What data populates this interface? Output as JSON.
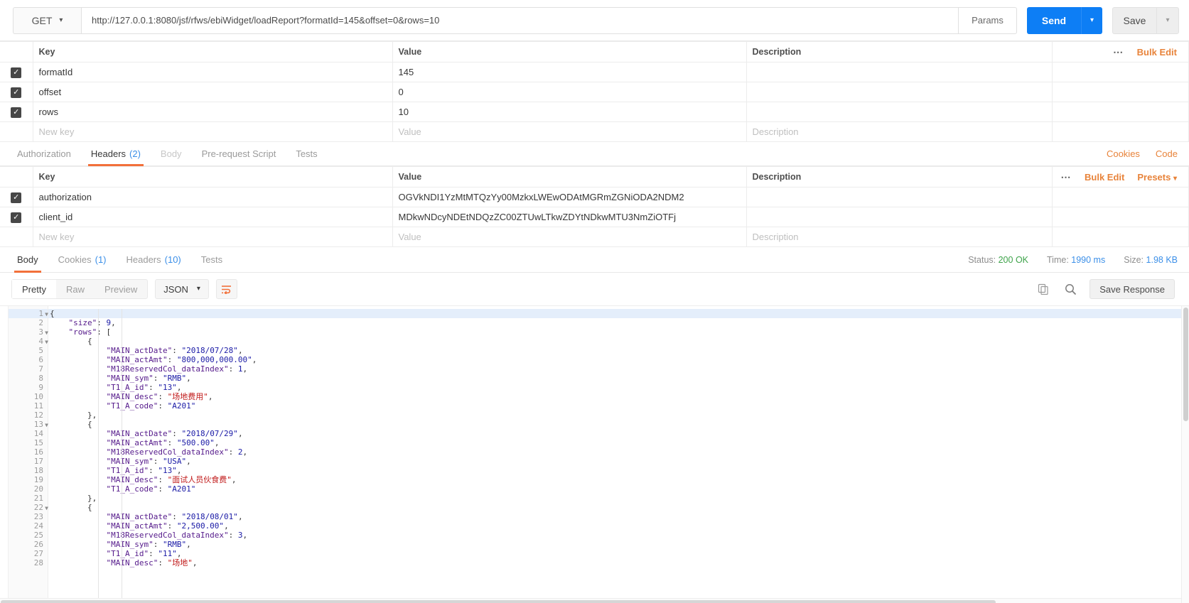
{
  "urlbar": {
    "method": "GET",
    "url": "http://127.0.0.1:8080/jsf/rfws/ebiWidget/loadReport?formatId=145&offset=0&rows=10",
    "params_label": "Params",
    "send_label": "Send",
    "save_label": "Save"
  },
  "params_table": {
    "headers": {
      "key": "Key",
      "value": "Value",
      "description": "Description"
    },
    "bulk_edit": "Bulk Edit",
    "rows": [
      {
        "checked": true,
        "key": "formatId",
        "value": "145",
        "description": ""
      },
      {
        "checked": true,
        "key": "offset",
        "value": "0",
        "description": ""
      },
      {
        "checked": true,
        "key": "rows",
        "value": "10",
        "description": ""
      }
    ],
    "new_row": {
      "key": "New key",
      "value": "Value",
      "description": "Description"
    }
  },
  "request_tabs": {
    "items": [
      {
        "label": "Authorization",
        "count": "",
        "active": false,
        "dim": false
      },
      {
        "label": "Headers",
        "count": "(2)",
        "active": true,
        "dim": false
      },
      {
        "label": "Body",
        "count": "",
        "active": false,
        "dim": true
      },
      {
        "label": "Pre-request Script",
        "count": "",
        "active": false,
        "dim": false
      },
      {
        "label": "Tests",
        "count": "",
        "active": false,
        "dim": false
      }
    ],
    "cookies_link": "Cookies",
    "code_link": "Code"
  },
  "headers_table": {
    "headers": {
      "key": "Key",
      "value": "Value",
      "description": "Description"
    },
    "bulk_edit": "Bulk Edit",
    "presets": "Presets",
    "rows": [
      {
        "checked": true,
        "key": "authorization",
        "value": "OGVkNDI1YzMtMTQzYy00MzkxLWEwODAtMGRmZGNiODA2NDM2",
        "description": ""
      },
      {
        "checked": true,
        "key": "client_id",
        "value": "MDkwNDcyNDEtNDQzZC00ZTUwLTkwZDYtNDkwMTU3NmZiOTFj",
        "description": ""
      }
    ],
    "new_row": {
      "key": "New key",
      "value": "Value",
      "description": "Description"
    }
  },
  "response_tabs": {
    "items": [
      {
        "label": "Body",
        "count": "",
        "active": true
      },
      {
        "label": "Cookies",
        "count": "(1)",
        "active": false
      },
      {
        "label": "Headers",
        "count": "(10)",
        "active": false
      },
      {
        "label": "Tests",
        "count": "",
        "active": false
      }
    ],
    "status_label": "Status:",
    "status_value": "200 OK",
    "time_label": "Time:",
    "time_value": "1990 ms",
    "size_label": "Size:",
    "size_value": "1.98 KB"
  },
  "editor_toolbar": {
    "pretty": "Pretty",
    "raw": "Raw",
    "preview": "Preview",
    "format": "JSON",
    "save_response": "Save Response"
  },
  "response_body": {
    "lines": [
      {
        "n": 1,
        "fold": true,
        "hl": true,
        "tokens": [
          [
            "p",
            "{"
          ]
        ]
      },
      {
        "n": 2,
        "fold": false,
        "hl": false,
        "tokens": [
          [
            "p",
            "    "
          ],
          [
            "k",
            "\"size\""
          ],
          [
            "p",
            ": "
          ],
          [
            "n",
            "9"
          ],
          [
            "p",
            ","
          ]
        ]
      },
      {
        "n": 3,
        "fold": true,
        "hl": false,
        "tokens": [
          [
            "p",
            "    "
          ],
          [
            "k",
            "\"rows\""
          ],
          [
            "p",
            ": ["
          ]
        ]
      },
      {
        "n": 4,
        "fold": true,
        "hl": false,
        "tokens": [
          [
            "p",
            "        {"
          ]
        ]
      },
      {
        "n": 5,
        "fold": false,
        "hl": false,
        "tokens": [
          [
            "p",
            "            "
          ],
          [
            "k",
            "\"MAIN_actDate\""
          ],
          [
            "p",
            ": "
          ],
          [
            "s",
            "\"2018/07/28\""
          ],
          [
            "p",
            ","
          ]
        ]
      },
      {
        "n": 6,
        "fold": false,
        "hl": false,
        "tokens": [
          [
            "p",
            "            "
          ],
          [
            "k",
            "\"MAIN_actAmt\""
          ],
          [
            "p",
            ": "
          ],
          [
            "s",
            "\"800,000,000.00\""
          ],
          [
            "p",
            ","
          ]
        ]
      },
      {
        "n": 7,
        "fold": false,
        "hl": false,
        "tokens": [
          [
            "p",
            "            "
          ],
          [
            "k",
            "\"M18ReservedCol_dataIndex\""
          ],
          [
            "p",
            ": "
          ],
          [
            "n",
            "1"
          ],
          [
            "p",
            ","
          ]
        ]
      },
      {
        "n": 8,
        "fold": false,
        "hl": false,
        "tokens": [
          [
            "p",
            "            "
          ],
          [
            "k",
            "\"MAIN_sym\""
          ],
          [
            "p",
            ": "
          ],
          [
            "s",
            "\"RMB\""
          ],
          [
            "p",
            ","
          ]
        ]
      },
      {
        "n": 9,
        "fold": false,
        "hl": false,
        "tokens": [
          [
            "p",
            "            "
          ],
          [
            "k",
            "\"T1_A_id\""
          ],
          [
            "p",
            ": "
          ],
          [
            "s",
            "\"13\""
          ],
          [
            "p",
            ","
          ]
        ]
      },
      {
        "n": 10,
        "fold": false,
        "hl": false,
        "tokens": [
          [
            "p",
            "            "
          ],
          [
            "k",
            "\"MAIN_desc\""
          ],
          [
            "p",
            ": "
          ],
          [
            "cn",
            "\"场地费用\""
          ],
          [
            "p",
            ","
          ]
        ]
      },
      {
        "n": 11,
        "fold": false,
        "hl": false,
        "tokens": [
          [
            "p",
            "            "
          ],
          [
            "k",
            "\"T1_A_code\""
          ],
          [
            "p",
            ": "
          ],
          [
            "s",
            "\"A201\""
          ]
        ]
      },
      {
        "n": 12,
        "fold": false,
        "hl": false,
        "tokens": [
          [
            "p",
            "        },"
          ]
        ]
      },
      {
        "n": 13,
        "fold": true,
        "hl": false,
        "tokens": [
          [
            "p",
            "        {"
          ]
        ]
      },
      {
        "n": 14,
        "fold": false,
        "hl": false,
        "tokens": [
          [
            "p",
            "            "
          ],
          [
            "k",
            "\"MAIN_actDate\""
          ],
          [
            "p",
            ": "
          ],
          [
            "s",
            "\"2018/07/29\""
          ],
          [
            "p",
            ","
          ]
        ]
      },
      {
        "n": 15,
        "fold": false,
        "hl": false,
        "tokens": [
          [
            "p",
            "            "
          ],
          [
            "k",
            "\"MAIN_actAmt\""
          ],
          [
            "p",
            ": "
          ],
          [
            "s",
            "\"500.00\""
          ],
          [
            "p",
            ","
          ]
        ]
      },
      {
        "n": 16,
        "fold": false,
        "hl": false,
        "tokens": [
          [
            "p",
            "            "
          ],
          [
            "k",
            "\"M18ReservedCol_dataIndex\""
          ],
          [
            "p",
            ": "
          ],
          [
            "n",
            "2"
          ],
          [
            "p",
            ","
          ]
        ]
      },
      {
        "n": 17,
        "fold": false,
        "hl": false,
        "tokens": [
          [
            "p",
            "            "
          ],
          [
            "k",
            "\"MAIN_sym\""
          ],
          [
            "p",
            ": "
          ],
          [
            "s",
            "\"USA\""
          ],
          [
            "p",
            ","
          ]
        ]
      },
      {
        "n": 18,
        "fold": false,
        "hl": false,
        "tokens": [
          [
            "p",
            "            "
          ],
          [
            "k",
            "\"T1_A_id\""
          ],
          [
            "p",
            ": "
          ],
          [
            "s",
            "\"13\""
          ],
          [
            "p",
            ","
          ]
        ]
      },
      {
        "n": 19,
        "fold": false,
        "hl": false,
        "tokens": [
          [
            "p",
            "            "
          ],
          [
            "k",
            "\"MAIN_desc\""
          ],
          [
            "p",
            ": "
          ],
          [
            "cn",
            "\"面试人员伙食费\""
          ],
          [
            "p",
            ","
          ]
        ]
      },
      {
        "n": 20,
        "fold": false,
        "hl": false,
        "tokens": [
          [
            "p",
            "            "
          ],
          [
            "k",
            "\"T1_A_code\""
          ],
          [
            "p",
            ": "
          ],
          [
            "s",
            "\"A201\""
          ]
        ]
      },
      {
        "n": 21,
        "fold": false,
        "hl": false,
        "tokens": [
          [
            "p",
            "        },"
          ]
        ]
      },
      {
        "n": 22,
        "fold": true,
        "hl": false,
        "tokens": [
          [
            "p",
            "        {"
          ]
        ]
      },
      {
        "n": 23,
        "fold": false,
        "hl": false,
        "tokens": [
          [
            "p",
            "            "
          ],
          [
            "k",
            "\"MAIN_actDate\""
          ],
          [
            "p",
            ": "
          ],
          [
            "s",
            "\"2018/08/01\""
          ],
          [
            "p",
            ","
          ]
        ]
      },
      {
        "n": 24,
        "fold": false,
        "hl": false,
        "tokens": [
          [
            "p",
            "            "
          ],
          [
            "k",
            "\"MAIN_actAmt\""
          ],
          [
            "p",
            ": "
          ],
          [
            "s",
            "\"2,500.00\""
          ],
          [
            "p",
            ","
          ]
        ]
      },
      {
        "n": 25,
        "fold": false,
        "hl": false,
        "tokens": [
          [
            "p",
            "            "
          ],
          [
            "k",
            "\"M18ReservedCol_dataIndex\""
          ],
          [
            "p",
            ": "
          ],
          [
            "n",
            "3"
          ],
          [
            "p",
            ","
          ]
        ]
      },
      {
        "n": 26,
        "fold": false,
        "hl": false,
        "tokens": [
          [
            "p",
            "            "
          ],
          [
            "k",
            "\"MAIN_sym\""
          ],
          [
            "p",
            ": "
          ],
          [
            "s",
            "\"RMB\""
          ],
          [
            "p",
            ","
          ]
        ]
      },
      {
        "n": 27,
        "fold": false,
        "hl": false,
        "tokens": [
          [
            "p",
            "            "
          ],
          [
            "k",
            "\"T1_A_id\""
          ],
          [
            "p",
            ": "
          ],
          [
            "s",
            "\"11\""
          ],
          [
            "p",
            ","
          ]
        ]
      },
      {
        "n": 28,
        "fold": false,
        "hl": false,
        "tokens": [
          [
            "p",
            "            "
          ],
          [
            "k",
            "\"MAIN_desc\""
          ],
          [
            "p",
            ": "
          ],
          [
            "cn",
            "\"场地\""
          ],
          [
            "p",
            ","
          ]
        ]
      }
    ]
  },
  "colors": {
    "accent_orange": "#f2703a",
    "send_blue": "#0d7ef5",
    "link_blue": "#3b8fe8",
    "status_green": "#3ea34a"
  }
}
